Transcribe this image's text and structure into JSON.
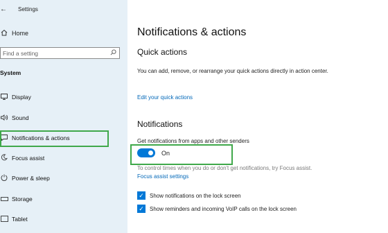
{
  "window": {
    "back_glyph": "←",
    "title": "Settings"
  },
  "sidebar": {
    "home_label": "Home",
    "search_placeholder": "Find a setting",
    "section": "System",
    "items": [
      {
        "label": "Display",
        "icon": "display-icon"
      },
      {
        "label": "Sound",
        "icon": "sound-icon"
      },
      {
        "label": "Notifications & actions",
        "icon": "notifications-icon",
        "selected": true
      },
      {
        "label": "Focus assist",
        "icon": "focus-assist-icon"
      },
      {
        "label": "Power & sleep",
        "icon": "power-icon"
      },
      {
        "label": "Storage",
        "icon": "storage-icon"
      },
      {
        "label": "Tablet",
        "icon": "tablet-icon"
      }
    ]
  },
  "main": {
    "title": "Notifications & actions",
    "quick_actions": {
      "heading": "Quick actions",
      "description": "You can add, remove, or rearrange your quick actions directly in action center.",
      "link": "Edit your quick actions"
    },
    "notifications": {
      "heading": "Notifications",
      "toggle_label": "Get notifications from apps and other senders",
      "toggle_state": "On",
      "focus_hint": "To control times when you do or don't get notifications, try Focus assist.",
      "focus_link": "Focus assist settings",
      "checkboxes": [
        {
          "label": "Show notifications on the lock screen",
          "checked": true
        },
        {
          "label": "Show reminders and incoming VoIP calls on the lock screen",
          "checked": true
        }
      ]
    }
  },
  "colors": {
    "accent": "#0078d7",
    "link": "#0067b8",
    "highlight": "#3fa84a",
    "sidebar_bg": "#e6f0f7"
  }
}
